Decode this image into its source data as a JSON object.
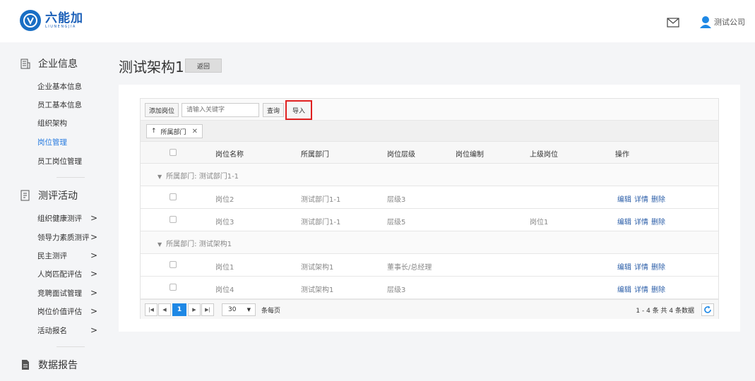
{
  "header": {
    "logo_cn": "六能加",
    "logo_en": "LIUNENGJIA",
    "user_name": "测试公司"
  },
  "sidebar": {
    "section1": {
      "title": "企业信息",
      "items": [
        "企业基本信息",
        "员工基本信息",
        "组织架构",
        "岗位管理",
        "员工岗位管理"
      ]
    },
    "section2": {
      "title": "测评活动",
      "items": [
        "组织健康测评",
        "领导力素质测评",
        "民主测评",
        "人岗匹配评估",
        "竞聘面试管理",
        "岗位价值评估",
        "活动报名"
      ]
    },
    "section3": {
      "title": "数据报告"
    },
    "chevron": ">"
  },
  "main": {
    "title": "测试架构1",
    "back_label": "返回",
    "toolbar": {
      "add_label": "添加岗位",
      "search_placeholder": "请输入关键字",
      "query_label": "查询",
      "import_label": "导入"
    },
    "group_chip": {
      "arrow": "↑",
      "label": "所属部门",
      "close": "✕"
    },
    "columns": [
      "岗位名称",
      "所属部门",
      "岗位层级",
      "岗位编制",
      "上级岗位",
      "操作"
    ],
    "groups": [
      {
        "label": "所属部门: 测试部门1-1",
        "rows": [
          {
            "name": "岗位2",
            "dept": "测试部门1-1",
            "level": "层级3",
            "quota": "",
            "parent": ""
          },
          {
            "name": "岗位3",
            "dept": "测试部门1-1",
            "level": "层级5",
            "quota": "",
            "parent": "岗位1"
          }
        ]
      },
      {
        "label": "所属部门: 测试架构1",
        "rows": [
          {
            "name": "岗位1",
            "dept": "测试架构1",
            "level": "董事长/总经理",
            "quota": "",
            "parent": ""
          },
          {
            "name": "岗位4",
            "dept": "测试架构1",
            "level": "层级3",
            "quota": "",
            "parent": ""
          }
        ]
      }
    ],
    "ops": {
      "edit": "编辑",
      "detail": "详情",
      "delete": "删除"
    },
    "pager": {
      "first": "⏮",
      "prev": "◀",
      "current": "1",
      "next": "▶",
      "last": "⏭",
      "page_size": "30",
      "page_size_label": "条每页",
      "info": "1 - 4 条   共 4 条数据"
    }
  },
  "colors": {
    "accent": "#1e88e5",
    "brand": "#1a5fb8",
    "link": "#2b5ea8",
    "highlight": "#e02020"
  }
}
